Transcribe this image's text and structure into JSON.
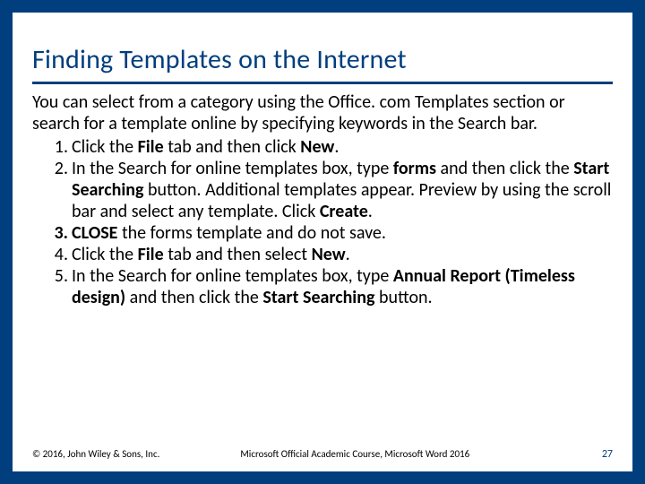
{
  "title": "Finding Templates on the Internet",
  "intro": "You can select from a category using the Office. com Templates section or search for a template online by specifying keywords in the Search bar.",
  "steps": {
    "s1": {
      "a": "Click the ",
      "b": "File",
      "c": " tab and then click ",
      "d": "New",
      "e": "."
    },
    "s2": {
      "a": "In the Search for online templates box, type ",
      "b": "forms",
      "c": " and then click the ",
      "d": "Start Searching",
      "e": " button. Additional templates appear. Preview by using the scroll bar and select any template. Click ",
      "f": "Create",
      "g": "."
    },
    "s3": {
      "a": "CLOSE",
      "b": " the forms template and do not save."
    },
    "s4": {
      "a": "Click the ",
      "b": "File",
      "c": " tab and then select ",
      "d": "New",
      "e": "."
    },
    "s5": {
      "a": "In the Search for online templates box, type ",
      "b": "Annual Report (Timeless design)",
      "c": " and then click the ",
      "d": "Start Searching",
      "e": " button."
    }
  },
  "footer": {
    "copyright": "© 2016, John Wiley & Sons, Inc.",
    "course": "Microsoft Official Academic Course, Microsoft Word 2016",
    "page": "27"
  }
}
